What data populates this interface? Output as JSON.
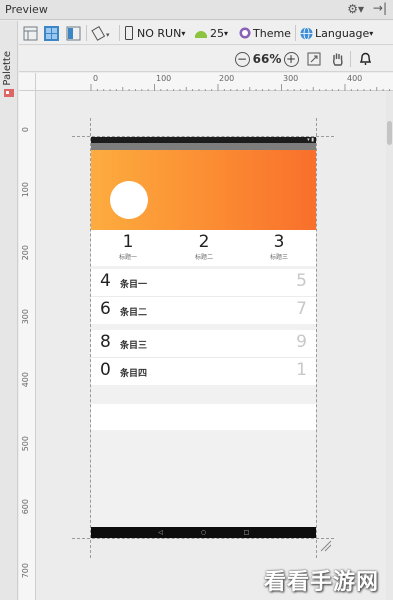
{
  "window": {
    "title": "Preview"
  },
  "palette": {
    "label": "Palette"
  },
  "toolbar": {
    "run_config": "NO RUN",
    "api_level": "25",
    "theme": "Theme",
    "language": "Language"
  },
  "zoom": {
    "level": "66%"
  },
  "ruler": {
    "h_labels": [
      "0",
      "100",
      "200",
      "300",
      "400"
    ],
    "v_labels": [
      "0",
      "100",
      "200",
      "300",
      "400",
      "500",
      "600",
      "700"
    ]
  },
  "app": {
    "header_gradient": [
      "#fdac3f",
      "#f96f2c"
    ],
    "stats": [
      {
        "value": "1",
        "label": "标题一"
      },
      {
        "value": "2",
        "label": "标题二"
      },
      {
        "value": "3",
        "label": "标题三"
      }
    ],
    "group1": [
      {
        "left": "4",
        "text": "条目一",
        "right": "5"
      },
      {
        "left": "6",
        "text": "条目二",
        "right": "7"
      }
    ],
    "group2": [
      {
        "left": "8",
        "text": "条目三",
        "right": "9"
      },
      {
        "left": "0",
        "text": "条目四",
        "right": "1"
      }
    ]
  },
  "watermark": {
    "text": "看看手游网"
  }
}
